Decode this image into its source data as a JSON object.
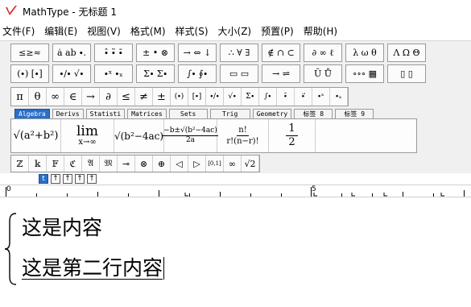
{
  "window": {
    "title": "MathType - 无标题 1",
    "logo_icon": "mathtype-logo-icon",
    "logo_color": "#d62b2b"
  },
  "menu": [
    {
      "label": "文件(F)"
    },
    {
      "label": "编辑(E)"
    },
    {
      "label": "视图(V)"
    },
    {
      "label": "格式(M)"
    },
    {
      "label": "样式(S)"
    },
    {
      "label": "大小(Z)"
    },
    {
      "label": "预置(P)"
    },
    {
      "label": "帮助(H)"
    }
  ],
  "palette_row1": [
    {
      "glyph": "≤≥≈",
      "name": "relations-palette"
    },
    {
      "glyph": "ȧ ab ∙.",
      "name": "spaces-palette"
    },
    {
      "glyph": "∙̂ ∙̃ ∙̄",
      "name": "embellishments-palette"
    },
    {
      "glyph": "± • ⊗",
      "name": "operators-palette"
    },
    {
      "glyph": "→ ⇔ ↓",
      "name": "arrows-palette"
    },
    {
      "glyph": "∴ ∀ ∃",
      "name": "logic-palette"
    },
    {
      "glyph": "∉ ∩ ⊂",
      "name": "set-theory-palette"
    },
    {
      "glyph": "∂ ∞ ℓ",
      "name": "misc-symbols-palette"
    },
    {
      "glyph": "λ ω θ",
      "name": "greek-lower-palette"
    },
    {
      "glyph": "Λ Ω Θ",
      "name": "greek-upper-palette"
    }
  ],
  "palette_row2": [
    {
      "glyph": "(∙) [∙]",
      "name": "fences-palette"
    },
    {
      "glyph": "∙/∙ √∙",
      "name": "fractions-radicals-palette"
    },
    {
      "glyph": "∙ˣ ∙ₓ",
      "name": "scripts-palette"
    },
    {
      "glyph": "Σ∙ Σ∙",
      "name": "summations-palette"
    },
    {
      "glyph": "∫∙ ∮∙",
      "name": "integrals-palette"
    },
    {
      "glyph": "▭ ▭",
      "name": "bars-palette"
    },
    {
      "glyph": "→ ⇌",
      "name": "labeled-arrows-palette"
    },
    {
      "glyph": "Ū Ů",
      "name": "products-palette"
    },
    {
      "glyph": "∘∘∘ ▦",
      "name": "matrices-palette"
    },
    {
      "glyph": "▯ ▯",
      "name": "boxes-palette"
    }
  ],
  "symbol_bar": [
    {
      "glyph": "π",
      "name": "pi-symbol"
    },
    {
      "glyph": "θ",
      "name": "theta-symbol"
    },
    {
      "glyph": "∞",
      "name": "infinity-symbol"
    },
    {
      "glyph": "∈",
      "name": "element-of-symbol"
    },
    {
      "glyph": "→",
      "name": "right-arrow-symbol"
    },
    {
      "glyph": "∂",
      "name": "partial-symbol"
    },
    {
      "glyph": "≤",
      "name": "less-equal-symbol"
    },
    {
      "glyph": "≠",
      "name": "not-equal-symbol"
    },
    {
      "glyph": "±",
      "name": "plus-minus-symbol"
    },
    {
      "glyph": "(∙)",
      "name": "parens-template"
    },
    {
      "glyph": "[∙]",
      "name": "brackets-template"
    },
    {
      "glyph": "∙/∙",
      "name": "fraction-template"
    },
    {
      "glyph": "√∙",
      "name": "sqrt-template"
    },
    {
      "glyph": "Σ∙",
      "name": "sum-template"
    },
    {
      "glyph": "∫∙",
      "name": "integral-template"
    },
    {
      "glyph": "∙̄",
      "name": "overbar-template"
    },
    {
      "glyph": "∙⃗",
      "name": "vector-template"
    },
    {
      "glyph": "∙ˣ",
      "name": "superscript-template"
    },
    {
      "glyph": "∙ₓ",
      "name": "subscript-template"
    }
  ],
  "tabs": [
    {
      "label": "Algebra",
      "active": true
    },
    {
      "label": "Derivs",
      "active": false
    },
    {
      "label": "Statisti",
      "active": false
    },
    {
      "label": "Matrices",
      "active": false
    },
    {
      "label": "Sets",
      "active": false
    },
    {
      "label": "Trig",
      "active": false
    },
    {
      "label": "Geometry",
      "active": false
    },
    {
      "label": "标签 8",
      "active": false
    },
    {
      "label": "标签 9",
      "active": false
    }
  ],
  "templates": {
    "t1": "√(a²+b²)",
    "t2_top": "lim",
    "t2_bottom": "x→∞",
    "t3": "√(b²−4ac)",
    "t4_top": "−b±√(b²−4ac)",
    "t4_bottom": "2a",
    "t5_top": "n!",
    "t5_bottom": "r!(n−r)!",
    "t6_top": "1",
    "t6_bottom": "2"
  },
  "small_row": [
    {
      "glyph": "ℤ",
      "name": "integers-symbol"
    },
    {
      "glyph": "𝕜",
      "name": "field-symbol"
    },
    {
      "glyph": "𝔽",
      "name": "double-f-symbol"
    },
    {
      "glyph": "ℭ",
      "name": "fraktur-c-symbol"
    },
    {
      "glyph": "𝔄",
      "name": "fraktur-a-symbol"
    },
    {
      "glyph": "𝔐",
      "name": "fraktur-m-symbol"
    },
    {
      "glyph": "⊸",
      "name": "multimap-symbol"
    },
    {
      "glyph": "⊗",
      "name": "circled-times-symbol"
    },
    {
      "glyph": "⊕",
      "name": "circled-plus-symbol"
    },
    {
      "glyph": "◁",
      "name": "left-triangle-symbol"
    },
    {
      "glyph": "▷",
      "name": "right-triangle-symbol"
    },
    {
      "glyph": "[0,1]",
      "name": "interval-template"
    },
    {
      "glyph": "∞",
      "name": "infinity-small-symbol"
    },
    {
      "glyph": "√2",
      "name": "sqrt2-template"
    }
  ],
  "nav_buttons": [
    {
      "glyph": "t",
      "active": true
    },
    {
      "glyph": "↑",
      "active": false
    },
    {
      "glyph": "↑",
      "active": false
    },
    {
      "glyph": "↑",
      "active": false
    },
    {
      "glyph": "↑",
      "active": false
    }
  ],
  "ruler": {
    "label_start": "0",
    "label_mid": "5"
  },
  "document": {
    "line1": "这是内容",
    "line2": "这是第二行内容"
  }
}
